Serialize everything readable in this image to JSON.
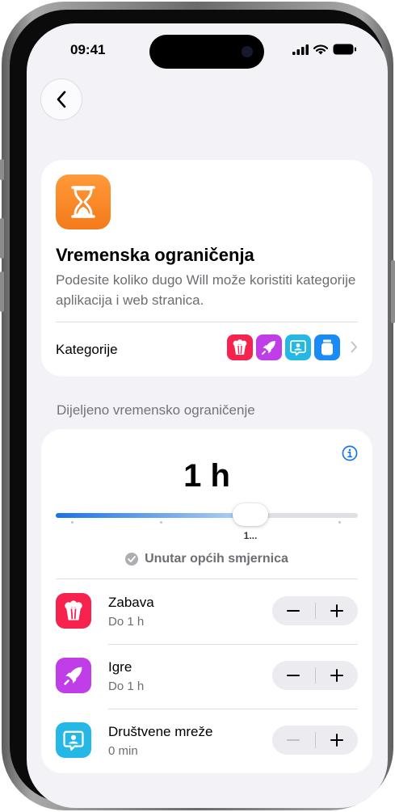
{
  "status_bar": {
    "time": "09:41"
  },
  "header": {
    "back_icon": "chevron-left-icon"
  },
  "intro_card": {
    "icon": "hourglass-icon",
    "title": "Vremenska ograničenja",
    "description": "Podesite koliko dugo Will može koristiti kategorije aplikacija i web stranica.",
    "categories_label": "Kategorije",
    "category_icons": [
      "popcorn-icon",
      "rocket-icon",
      "chat-person-icon",
      "jar-icon"
    ]
  },
  "shared_limit": {
    "section_title": "Dijeljeno vremensko ograničenje",
    "value": "1 h",
    "slider_label": "1...",
    "slider_fraction": 0.64,
    "guideline_text": "Unutar općih smjernica"
  },
  "categories": [
    {
      "name": "Zabava",
      "limit": "Do 1 h",
      "icon": "popcorn-icon",
      "color": "#f5234e",
      "minus_enabled": true
    },
    {
      "name": "Igre",
      "limit": "Do 1 h",
      "icon": "rocket-icon",
      "color": "#bf3ee8",
      "minus_enabled": true
    },
    {
      "name": "Društvene mreže",
      "limit": "0 min",
      "icon": "chat-person-icon",
      "color": "#25b8e6",
      "minus_enabled": false
    }
  ],
  "colors": {
    "accent": "#1973ea",
    "background": "#f2f2f7"
  }
}
